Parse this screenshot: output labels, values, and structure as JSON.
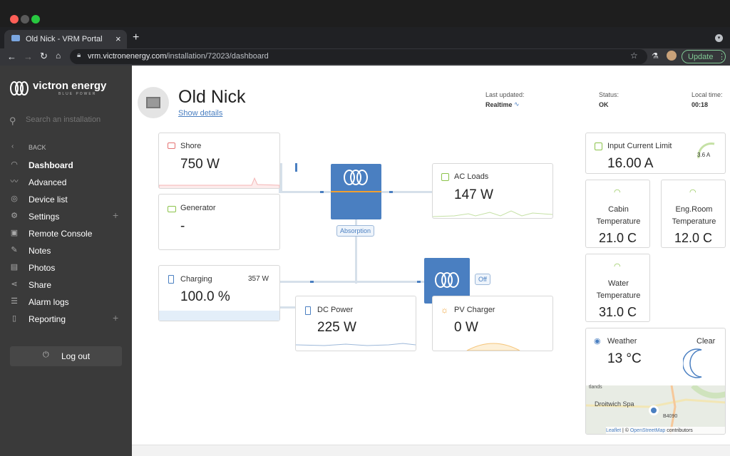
{
  "browser": {
    "tab_title": "Old Nick - VRM Portal",
    "url_host": "vrm.victronenergy.com",
    "url_path": "/installation/72023/dashboard",
    "update_label": "Update"
  },
  "colors": {
    "brand_blue": "#4a7fc1",
    "sidebar": "#3a3a3a",
    "ok_green": "#81c995",
    "shore_red": "#e57373"
  },
  "sidebar": {
    "logo": "victron energy",
    "logo_tag": "BLUE POWER",
    "search_placeholder": "Search an installation",
    "back": "BACK",
    "items": [
      {
        "label": "Dashboard",
        "icon": "gauge-icon"
      },
      {
        "label": "Advanced",
        "icon": "chart-icon"
      },
      {
        "label": "Device list",
        "icon": "pin-icon"
      },
      {
        "label": "Settings",
        "icon": "gear-icon"
      },
      {
        "label": "Remote Console",
        "icon": "console-icon"
      },
      {
        "label": "Notes",
        "icon": "pencil-icon"
      },
      {
        "label": "Photos",
        "icon": "photo-icon"
      },
      {
        "label": "Share",
        "icon": "share-icon"
      },
      {
        "label": "Alarm logs",
        "icon": "alarm-icon"
      },
      {
        "label": "Reporting",
        "icon": "report-icon"
      }
    ],
    "plus": "+",
    "logout": "Log out"
  },
  "header": {
    "title": "Old Nick",
    "show_details": "Show details",
    "last_updated_label": "Last updated:",
    "last_updated_value": "Realtime",
    "status_label": "Status:",
    "status_value": "OK",
    "local_time_label": "Local time:",
    "local_time_value": "00:18"
  },
  "flow": {
    "shore": {
      "title": "Shore",
      "value": "750 W"
    },
    "generator": {
      "title": "Generator",
      "value": "-"
    },
    "inverter_state": "Absorption",
    "ac_loads": {
      "title": "AC Loads",
      "value": "147 W"
    },
    "battery": {
      "title": "Charging",
      "power": "357 W",
      "value": "100.0 %"
    },
    "dc_power": {
      "title": "DC Power",
      "value": "225 W"
    },
    "pv": {
      "title": "PV Charger",
      "value": "0 W"
    },
    "mppt_state": "Off"
  },
  "widgets": {
    "input_limit": {
      "title": "Input Current Limit",
      "value": "16.00 A",
      "gauge": "3.6 A"
    },
    "cabin": {
      "title": "Cabin Temperature",
      "value": "21.0 C"
    },
    "engroom": {
      "title": "Eng.Room Temperature",
      "value": "12.0 C"
    },
    "water": {
      "title": "Water Temperature",
      "value": "31.0 C"
    },
    "weather": {
      "title": "Weather",
      "condition": "Clear",
      "value": "13 °C"
    },
    "map": {
      "place1": "Droitwich Spa",
      "place2": "B4090",
      "place3": "tlands",
      "attribution_leaflet": "Leaflet",
      "attribution_sep": " | © ",
      "attribution_osm": "OpenStreetMap",
      "attribution_tail": " contributors"
    }
  }
}
